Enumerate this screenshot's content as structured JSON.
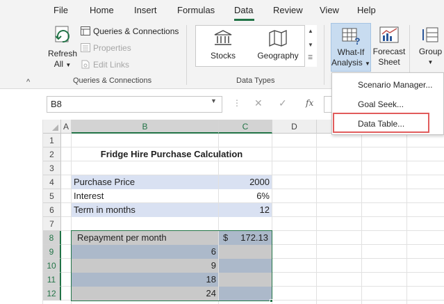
{
  "ribbon": {
    "tabs": [
      {
        "label": "File"
      },
      {
        "label": "Home"
      },
      {
        "label": "Insert"
      },
      {
        "label": "Formulas"
      },
      {
        "label": "Data",
        "active": true
      },
      {
        "label": "Review"
      },
      {
        "label": "View"
      },
      {
        "label": "Help"
      }
    ],
    "groups": {
      "queries": {
        "label": "Queries & Connections",
        "refresh_all_line1": "Refresh",
        "refresh_all_line2": "All",
        "queries_connections": "Queries & Connections",
        "properties": "Properties",
        "edit_links": "Edit Links"
      },
      "data_types": {
        "label": "Data Types",
        "stocks": "Stocks",
        "geography": "Geography"
      },
      "forecast": {
        "what_if_line1": "What-If",
        "what_if_line2": "Analysis",
        "forecast_sheet_line1": "Forecast",
        "forecast_sheet_line2": "Sheet"
      },
      "outline": {
        "group": "Group"
      }
    },
    "accent_color": "#217346"
  },
  "what_if_menu": {
    "items": [
      {
        "label": "Scenario Manager...",
        "access_key": "S"
      },
      {
        "label": "Goal Seek...",
        "access_key": "G"
      },
      {
        "label": "Data Table...",
        "access_key": "T",
        "highlighted": true
      }
    ],
    "highlight_color": "#e15c5c"
  },
  "formula_bar": {
    "name_box": "B8",
    "fx": "fx",
    "cancel_icon": "close-icon",
    "enter_icon": "check-icon"
  },
  "sheet": {
    "columns": [
      "A",
      "B",
      "C",
      "D"
    ],
    "selected_columns": [
      "B",
      "C"
    ],
    "rows": [
      "1",
      "2",
      "3",
      "4",
      "5",
      "6",
      "7",
      "8",
      "9",
      "10",
      "11",
      "12"
    ],
    "selected_rows": [
      "8",
      "9",
      "10",
      "11",
      "12"
    ],
    "cells": {
      "B2": "Fridge Hire Purchase Calculation",
      "B4": "Purchase Price",
      "C4": "2000",
      "B5": "Interest",
      "C5": "6%",
      "B6": "Term in months",
      "C6": "12",
      "B8": "Repayment per month",
      "C8_currency": "$",
      "C8_value": "172.13",
      "B9": "6",
      "B10": "9",
      "B11": "18",
      "B12": "24"
    },
    "fills": {
      "input_rows": "#d9e1f2",
      "repayment_row": "#c9c9c9",
      "term_rows": "#acb9ca"
    }
  }
}
